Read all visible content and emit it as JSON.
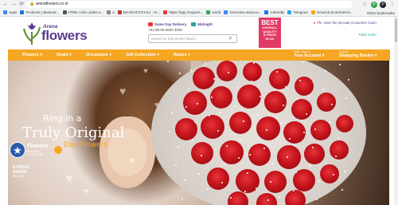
{
  "browser": {
    "url": "arenaflowers.co.in",
    "avatar_letter": "P",
    "bookmarks": [
      {
        "label": "Apps",
        "color": "#4285f4"
      },
      {
        "label": "Products | Bewinor...",
        "color": "#1a73e8"
      },
      {
        "label": "HTML color codes a...",
        "color": "#555"
      },
      {
        "label": "a",
        "color": "#888"
      },
      {
        "label": "BHARATSTHALI - Ar...",
        "color": "#c0392b"
      },
      {
        "label": "https://app.zoopore...",
        "color": "#e23a3a"
      },
      {
        "label": "world",
        "color": "#34a853"
      },
      {
        "label": "Overview www.ca...",
        "color": "#4285f4"
      },
      {
        "label": "Calendly",
        "color": "#1a73e8"
      },
      {
        "label": "Telegram",
        "color": "#2ca5e0"
      },
      {
        "label": "Email & Ecommerce...",
        "color": "#f5a623"
      }
    ],
    "other_bookmarks": "Other bookmarks"
  },
  "header": {
    "logo_small": "Arena",
    "logo_big": "flowers",
    "badge_sameday": "Same Day Delivery",
    "badge_midnight": "Midnight",
    "phone": "+91-98 00 0000 4000",
    "search_placeholder": "Search for that perfect flower...",
    "best_lines": [
      "BEST",
      "OVERALL",
      "QUALITY",
      "& PRICE",
      "IN UK"
    ],
    "deliver_to": "Pls. enter the pincode (Customer Care)",
    "track_order": "Track Order"
  },
  "nav": {
    "items": [
      "Flowers ▾",
      "Deals ▾",
      "Occasions ▾",
      "Gift Collection ▾",
      "Roses ▾"
    ],
    "account_small": "Hello, Sign in",
    "account": "Your Account ▾",
    "basket_small": "0 Items",
    "basket": "Shopping Basket ▾"
  },
  "hero": {
    "ring_line1": "Ring in a",
    "ring_line2": "Truly Original",
    "ring_line3": "Day Flowers",
    "award_title": "Flowers",
    "award_sub1": "SERVICE",
    "award_sub2": "EXCELLENT",
    "ethical_title": "ETHICAL",
    "ethical_sub": "AWARD",
    "ethical_year": "WINNER"
  }
}
